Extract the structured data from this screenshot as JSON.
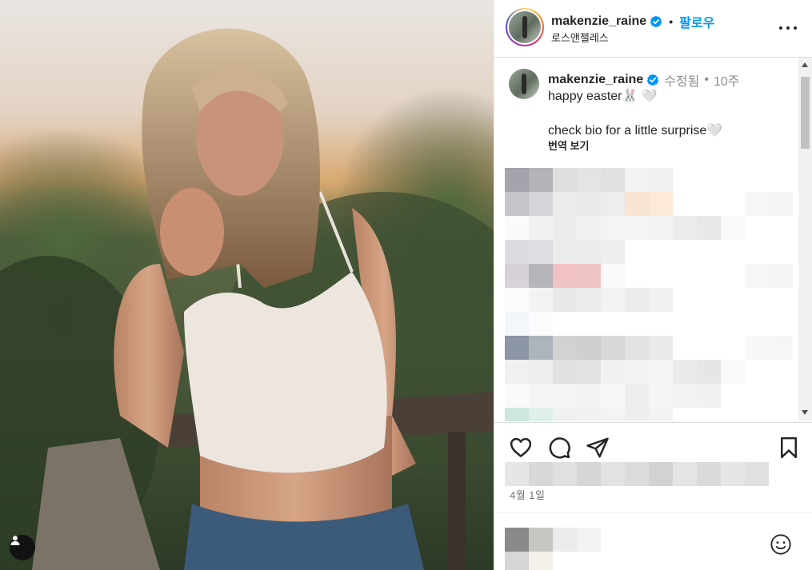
{
  "post": {
    "username": "makenzie_raine",
    "follow_label": "팔로우",
    "location": "로스앤젤레스",
    "caption": {
      "username": "makenzie_raine",
      "edited": "수정됨",
      "age": "10주",
      "line1": "happy easter🐰 🤍",
      "line2": "check bio for a little surprise🤍",
      "translate_label": "번역 보기"
    },
    "date": "4월 1일"
  },
  "icons": {
    "verified": "verified-badge-icon",
    "more": "more-options-icon",
    "like": "heart-icon",
    "comment": "comment-icon",
    "share": "share-icon",
    "save": "bookmark-icon",
    "emoji": "emoji-icon",
    "tags": "user-tag-icon"
  },
  "colors": {
    "accent": "#0095f6",
    "verified": "#0095f6",
    "text": "#262626",
    "secondary": "#8e8e8e"
  }
}
